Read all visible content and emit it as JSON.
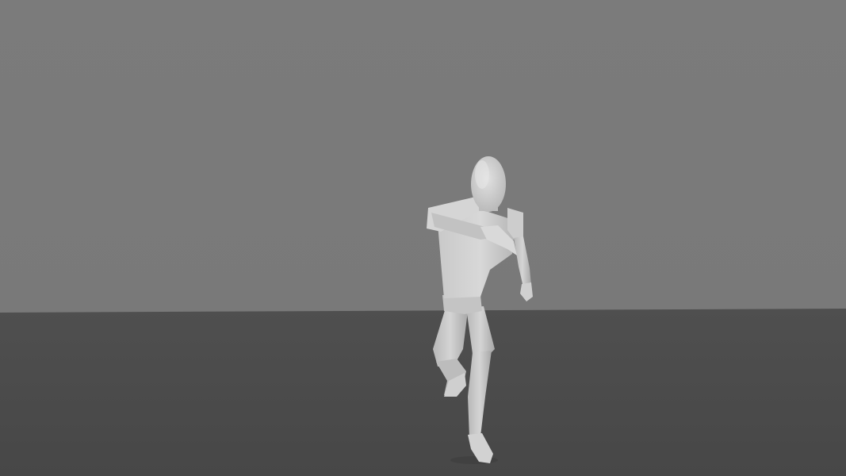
{
  "scene": {
    "subject": "mannequin-figure",
    "colors": {
      "wall": "#7a7a7a",
      "floor": "#4b4b4b",
      "horizon": "#5a5a5a",
      "body_light": "#d6d6d6",
      "body_mid": "#bdbdbd",
      "body_shadow": "#9c9c9c",
      "shadow": "#3f3f3f"
    }
  }
}
